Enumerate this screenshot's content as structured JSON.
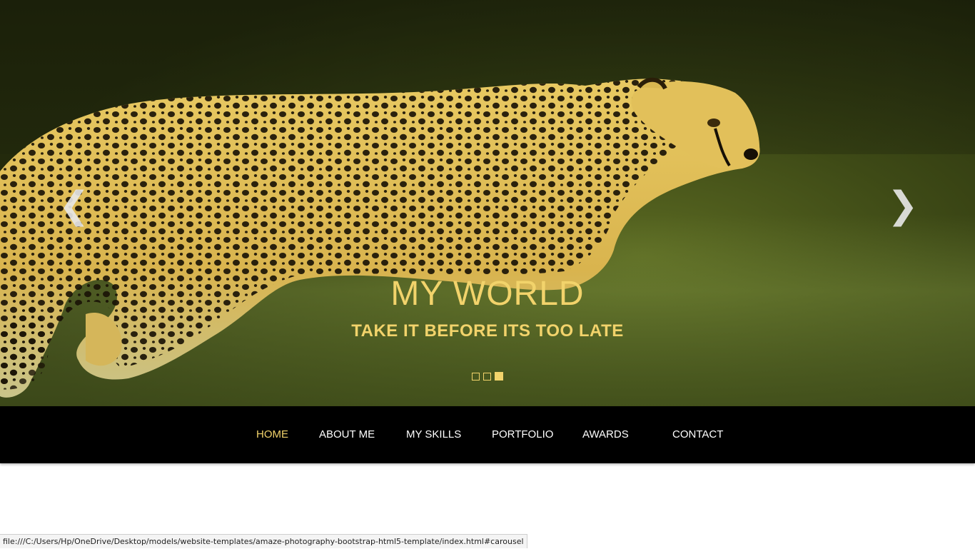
{
  "carousel": {
    "title": "MY WORLD",
    "subtitle": "TAKE IT BEFORE ITS TOO LATE",
    "prev_icon": "chevron-left-icon",
    "next_icon": "chevron-right-icon",
    "prev_glyph": "❮",
    "next_glyph": "❯",
    "slide_count": 3,
    "active_slide": 3,
    "background_image": "cheetah walking through grass",
    "accent_color": "#f2d36b"
  },
  "nav": {
    "items": [
      {
        "label": "HOME",
        "active": true
      },
      {
        "label": "ABOUT ME",
        "active": false
      },
      {
        "label": "MY SKILLS",
        "active": false
      },
      {
        "label": "PORTFOLIO",
        "active": false
      },
      {
        "label": "AWARDS",
        "active": false
      },
      {
        "label": "CONTACT",
        "active": false
      }
    ],
    "background_color": "#000000",
    "active_color": "#f2d36b",
    "text_color": "#ffffff"
  },
  "status_bar": {
    "url": "file:///C:/Users/Hp/OneDrive/Desktop/models/website-templates/amaze-photography-bootstrap-html5-template/index.html#carousel"
  }
}
